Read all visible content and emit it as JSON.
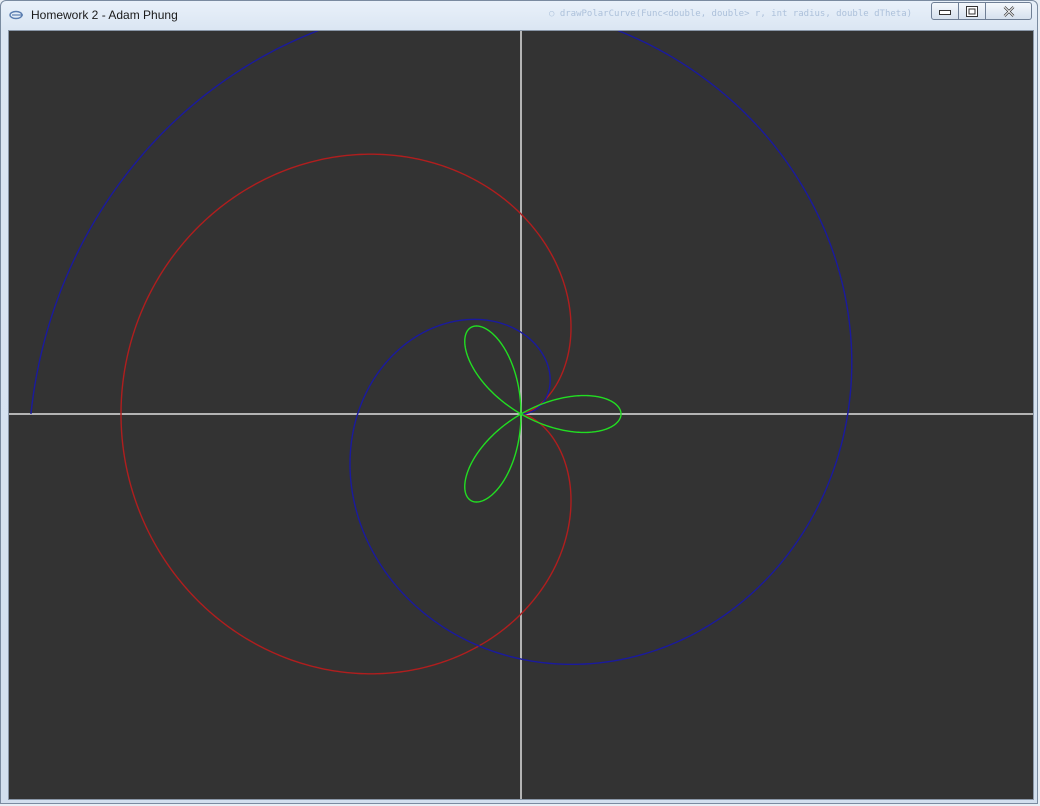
{
  "window": {
    "title": "Homework 2 - Adam Phung",
    "background_text": "○  drawPolarCurve(Func<double, double> r, int radius, double dTheta)",
    "controls": {
      "minimize": "minimize-icon",
      "maximize": "restore-icon",
      "close": "close-icon"
    }
  },
  "canvas": {
    "background": "#333333",
    "axes_color": "#b4b4b4",
    "curves": [
      {
        "color": "#b01e1e",
        "shape": "cardioid"
      },
      {
        "color": "#1a1a9e",
        "shape": "spiral"
      },
      {
        "color": "#22dd22",
        "shape": "three-leaf rose"
      }
    ]
  }
}
